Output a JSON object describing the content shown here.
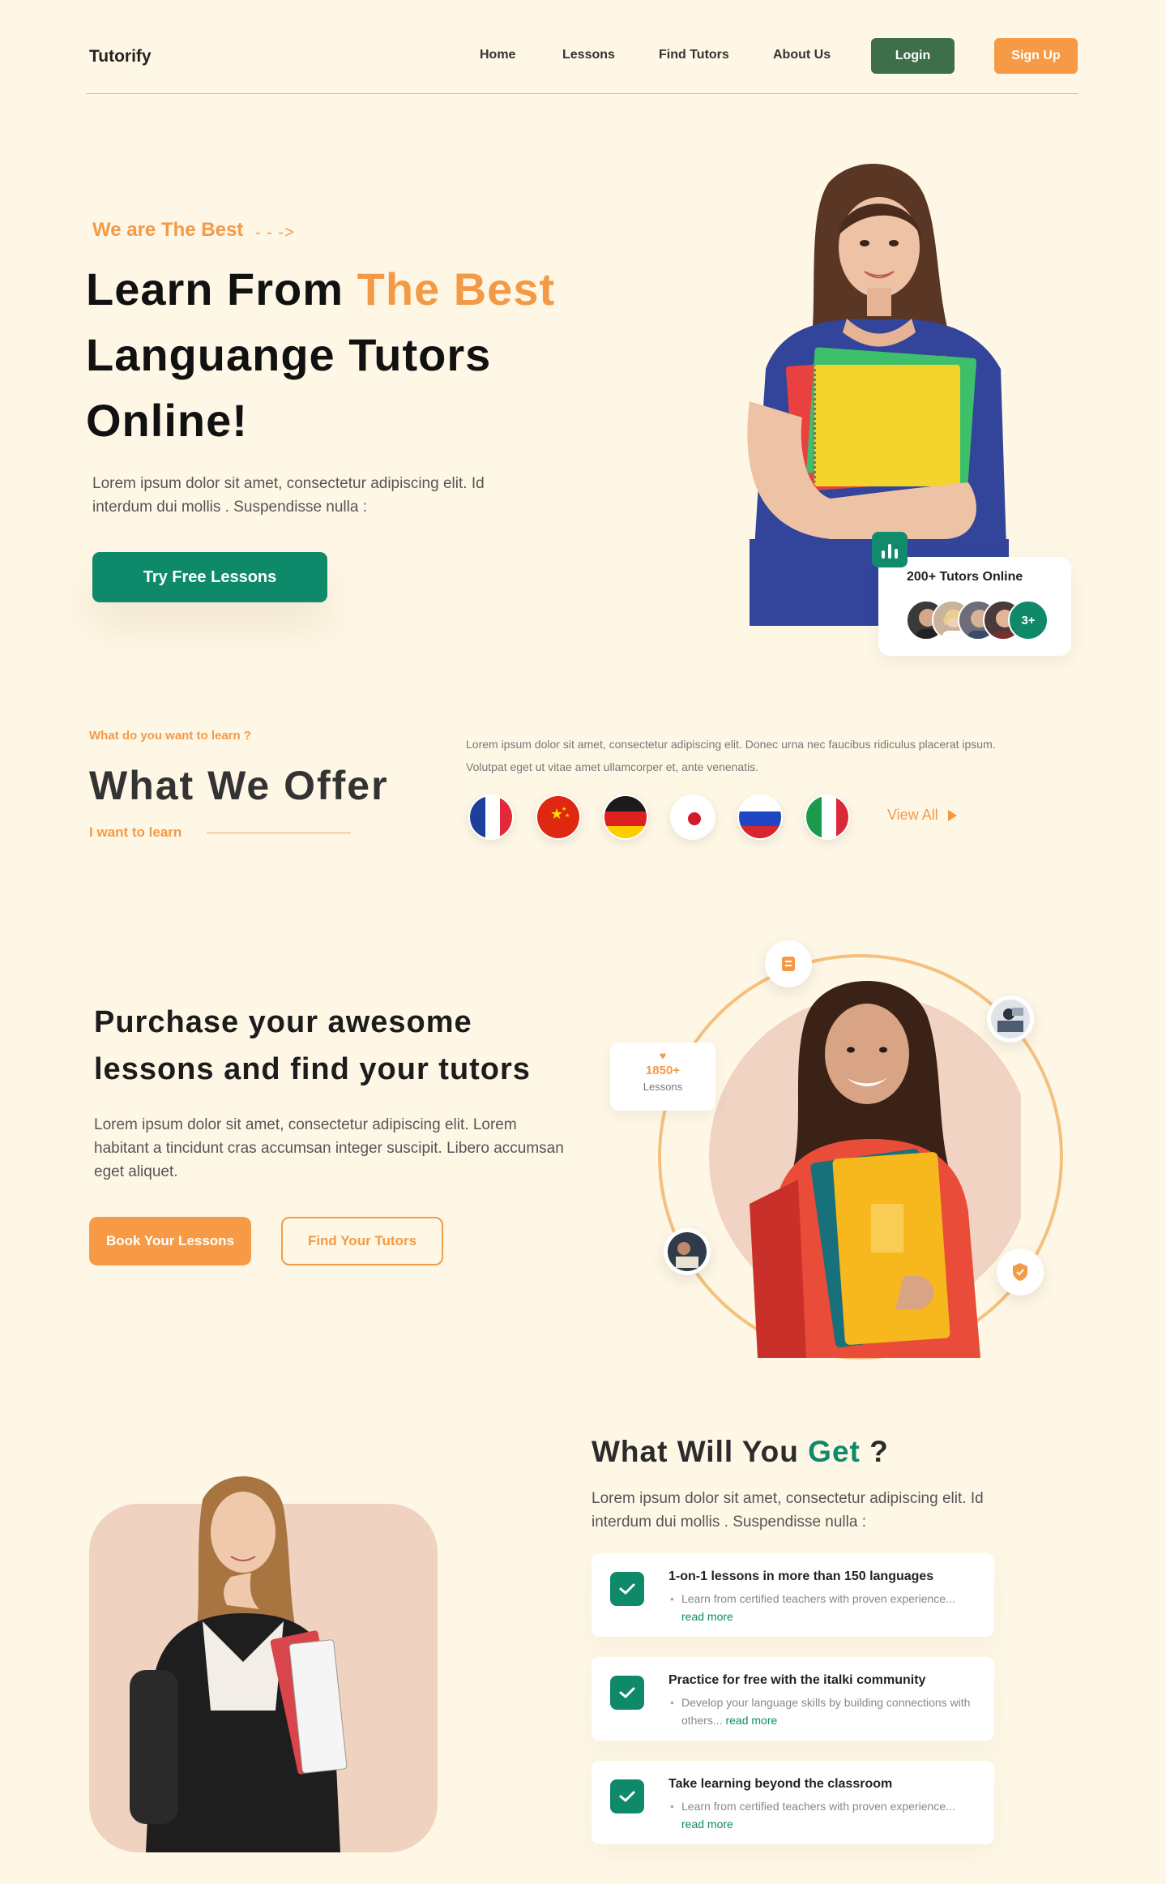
{
  "nav": {
    "logo": "Tutorify",
    "links": [
      "Home",
      "Lessons",
      "Find Tutors",
      "About Us"
    ],
    "login": "Login",
    "signup": "Sign Up"
  },
  "hero": {
    "eyebrow": "We are The Best",
    "eyebrow_arrow": "- - ->",
    "title_part1": "Learn From ",
    "title_accent": "The Best",
    "title_part2": "Languange Tutors Online!",
    "desc": "Lorem ipsum dolor sit amet, consectetur adipiscing elit. Id interdum dui mollis . Suspendisse nulla :",
    "cta": "Try Free Lessons",
    "tutors_label": "200+ Tutors Online",
    "tutors_more": "3+"
  },
  "offer": {
    "eyebrow": "What do you want to learn ?",
    "title": "What We Offer",
    "sub": "I want to learn",
    "desc": "Lorem ipsum dolor sit amet, consectetur adipiscing elit. Donec urna nec faucibus ridiculus placerat ipsum. Volutpat eget ut vitae amet ullamcorper et, ante venenatis.",
    "flags": [
      "france-flag",
      "china-flag",
      "germany-flag",
      "japan-flag",
      "russia-flag",
      "italy-flag"
    ],
    "view_all": "View All"
  },
  "purchase": {
    "title": "Purchase your awesome lessons and find your tutors",
    "desc": "Lorem ipsum dolor sit amet, consectetur adipiscing elit. Lorem habitant a tincidunt cras accumsan integer suscipit. Libero accumsan eget aliquet.",
    "book": "Book Your Lessons",
    "find": "Find Your Tutors",
    "lessons_num": "1850+",
    "lessons_lbl": "Lessons"
  },
  "get": {
    "title_part1": "What Will You ",
    "title_accent": "Get",
    "title_part2": " ?",
    "desc": "Lorem ipsum dolor sit amet, consectetur adipiscing elit. Id interdum dui mollis . Suspendisse nulla :",
    "features": [
      {
        "title": "1-on-1 lessons in more than 150 languages",
        "text": "Learn from certified teachers with proven experience...",
        "link": "read more"
      },
      {
        "title": "Practice for free with the italki community",
        "text": "Develop your language skills by building connections with others...",
        "link": "read more"
      },
      {
        "title": "Take learning beyond the classroom",
        "text": "Learn from certified teachers with proven experience...",
        "link": "read more"
      }
    ]
  },
  "colors": {
    "background": "#fff7e6",
    "accent_orange": "#f39a47",
    "accent_green": "#0e8a6b",
    "login_green": "#3f6e4a"
  }
}
